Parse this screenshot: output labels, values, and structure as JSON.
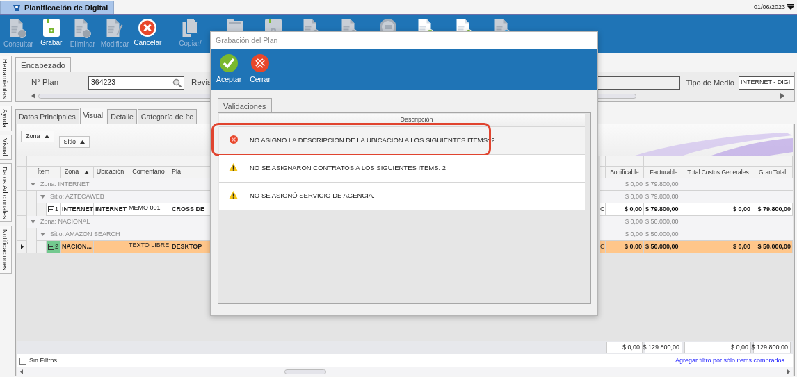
{
  "app": {
    "title": "Planificación de Digital",
    "date": "01/06/2023"
  },
  "toolbar": [
    {
      "label": "Consultar",
      "disabled": true
    },
    {
      "label": "Grabar",
      "disabled": false
    },
    {
      "label": "Eliminar",
      "disabled": true
    },
    {
      "label": "Modificar",
      "disabled": true
    },
    {
      "label": "Cancelar",
      "disabled": false
    },
    {
      "label": "Copiar/",
      "disabled": true
    },
    {
      "disabled": true
    },
    {
      "disabled": true
    },
    {
      "disabled": true
    },
    {
      "disabled": true
    },
    {
      "disabled": true
    },
    {
      "disabled": false
    },
    {
      "disabled": false
    },
    {
      "disabled": true
    }
  ],
  "side_tabs": [
    "Herramientas",
    "Ayuda",
    "Visual",
    "Datos Adicionales",
    "Notificaciones"
  ],
  "header": {
    "tab": "Encabezado",
    "plan_label": "N° Plan",
    "plan_value": "364223",
    "revision_label": "Revis",
    "media_label": "Tipo de Medio",
    "media_value": "INTERNET - DIGI"
  },
  "tabs": [
    {
      "label": "Datos Principales",
      "selected": false
    },
    {
      "label": "Visual",
      "selected": true
    },
    {
      "label": "Detalle",
      "selected": false
    },
    {
      "label": "Categoría de íte",
      "selected": false
    }
  ],
  "group_by": [
    "Zona",
    "Sitio"
  ],
  "grid": {
    "columns": [
      {
        "label": "Ítem",
        "sorted": false
      },
      {
        "label": "Zona",
        "sorted": true
      },
      {
        "label": "Ubicación",
        "sorted": false
      },
      {
        "label": "Comentario",
        "sorted": false
      },
      {
        "label": "Pla",
        "sorted": false
      }
    ],
    "value_columns": [
      "Bonificable",
      "Facturable",
      "Total Costos Generales",
      "Gran Total"
    ],
    "rows": [
      {
        "kind": "group",
        "label": "Zona: INTERNET",
        "expanded": true,
        "values": [
          "$ 0,00",
          "$ 79.800,00"
        ],
        "children": [
          {
            "kind": "group",
            "label": "Sitio: AZTECAWEB",
            "expanded": true,
            "values": [
              "$ 0,00",
              "$ 79.800,00"
            ],
            "children": [
              {
                "kind": "item",
                "selected": false,
                "cells": [
                  "1",
                  "INTERNET",
                  "INTERNET",
                  "MEMO 001",
                  "CROSS DE"
                ],
                "flag": "C",
                "values": [
                  "$ 0,00",
                  "$ 79.800,00",
                  "$ 0,00",
                  "$ 79.800,00"
                ]
              }
            ]
          }
        ]
      },
      {
        "kind": "group",
        "label": "Zona: NACIONAL",
        "expanded": true,
        "values": [
          "$ 0,00",
          "$ 50.000,00"
        ],
        "children": [
          {
            "kind": "group",
            "label": "Sitio: AMAZON SEARCH",
            "expanded": true,
            "values": [
              "$ 0,00",
              "$ 50.000,00"
            ],
            "children": [
              {
                "kind": "item",
                "selected": true,
                "cells": [
                  "2",
                  "NACION...",
                  null,
                  "TEXTO LIBRE",
                  "DESKTOP"
                ],
                "flag": "C",
                "values": [
                  "$ 0,00",
                  "$ 50.000,00",
                  "$ 0,00",
                  "$ 50.000,00"
                ]
              }
            ]
          }
        ]
      }
    ],
    "totals": [
      "$ 0,00",
      "$ 129.800,00",
      "$ 0,00",
      "$ 129.800,00"
    ]
  },
  "footer": {
    "filter_label": "Sin Filtros",
    "filter_checked": false,
    "link": "Agregar filtro por sólo items comprados"
  },
  "dialog": {
    "title": "Grabación del Plan",
    "actions": [
      {
        "label": "Aceptar",
        "kind": "accept"
      },
      {
        "label": "Cerrar",
        "kind": "close"
      }
    ],
    "tab": "Validaciones",
    "column": "Descripción",
    "validations": [
      {
        "kind": "error",
        "text": "NO ASIGNÓ LA DESCRIPCIÓN DE LA UBICACIÓN A LOS SIGUIENTES ÍTEMS: 2",
        "selected": true,
        "outlined": true
      },
      {
        "kind": "warning",
        "text": "NO SE ASIGNARON CONTRATOS A LOS SIGUIENTES ÍTEMS: 2",
        "selected": false,
        "outlined": false
      },
      {
        "kind": "warning",
        "text": "NO SE ASIGNÓ SERVICIO DE AGENCIA.",
        "selected": false,
        "outlined": false
      }
    ]
  }
}
